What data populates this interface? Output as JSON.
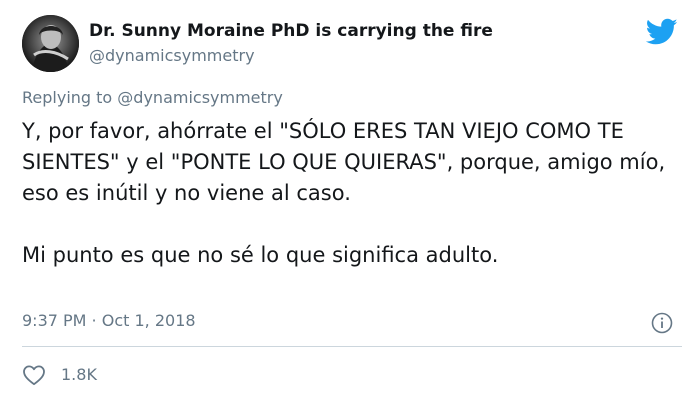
{
  "author": {
    "name": "Dr. Sunny Moraine PhD is carrying the fire",
    "handle": "@dynamicsymmetry"
  },
  "reply": {
    "prefix": "Replying to ",
    "handle": "@dynamicsymmetry"
  },
  "tweet": {
    "paragraphs": [
      "Y, por favor, ahórrate el \"SÓLO ERES TAN VIEJO COMO TE SIENTES\" y el \"PONTE LO QUE QUIERAS\", porque, amigo mío, eso es inútil y no viene al caso.",
      "Mi punto es que no sé lo que significa adulto."
    ]
  },
  "meta": {
    "time": "9:37 PM",
    "separator": " · ",
    "date": "Oct 1, 2018"
  },
  "actions": {
    "like_count": "1.8K"
  },
  "icons": {
    "logo": "twitter-bird-icon",
    "info": "info-icon",
    "like": "heart-icon"
  },
  "colors": {
    "brand": "#1da1f2",
    "text": "#14171a",
    "secondary": "#657786",
    "divider": "#ccd6dd"
  }
}
